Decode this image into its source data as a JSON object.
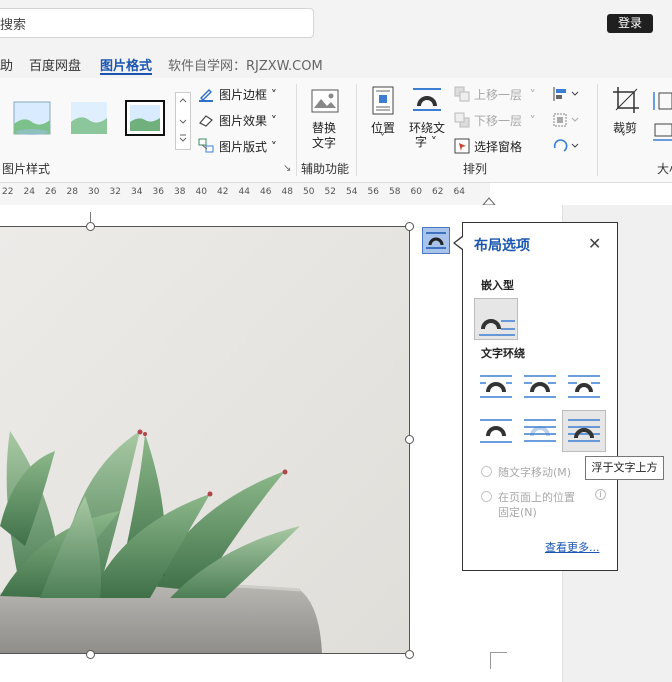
{
  "search": {
    "text": "搜索"
  },
  "account": {
    "login_label": "登录"
  },
  "tabs": [
    {
      "label": "助"
    },
    {
      "label": "百度网盘"
    },
    {
      "label": "图片格式",
      "active": true
    },
    {
      "label": "软件自学网：RJZXW.COM"
    }
  ],
  "ribbon": {
    "picture_styles": {
      "group_label": "图片样式"
    },
    "picture_border": "图片边框",
    "picture_effects": "图片效果",
    "picture_layout": "图片版式",
    "alt_text": {
      "line1": "替换",
      "line2": "文字"
    },
    "accessibility_label": "辅助功能",
    "position": "位置",
    "wrap_text": {
      "line1": "环绕文",
      "line2": "字"
    },
    "bring_forward": "上移一层",
    "send_backward": "下移一层",
    "selection_pane": "选择窗格",
    "arrange_label": "排列",
    "crop": "裁剪",
    "size_label_partial": "大小"
  },
  "ruler": {
    "ticks": [
      "22",
      "24",
      "26",
      "28",
      "30",
      "32",
      "34",
      "36",
      "38",
      "40",
      "42",
      "44",
      "46",
      "48",
      "50",
      "52",
      "54",
      "56",
      "58",
      "60",
      "62",
      "64"
    ]
  },
  "layout_popup": {
    "title": "布局选项",
    "inline_heading": "嵌入型",
    "wrap_heading": "文字环绕",
    "move_with_text": "随文字移动(M)",
    "fix_position_line1": "在页面上的位置",
    "fix_position_line2": "固定(N)",
    "see_more": "查看更多...",
    "tooltip": "浮于文字上方"
  },
  "colors": {
    "accent": "#1a56b0",
    "icon_blue": "#3b7fd4"
  }
}
